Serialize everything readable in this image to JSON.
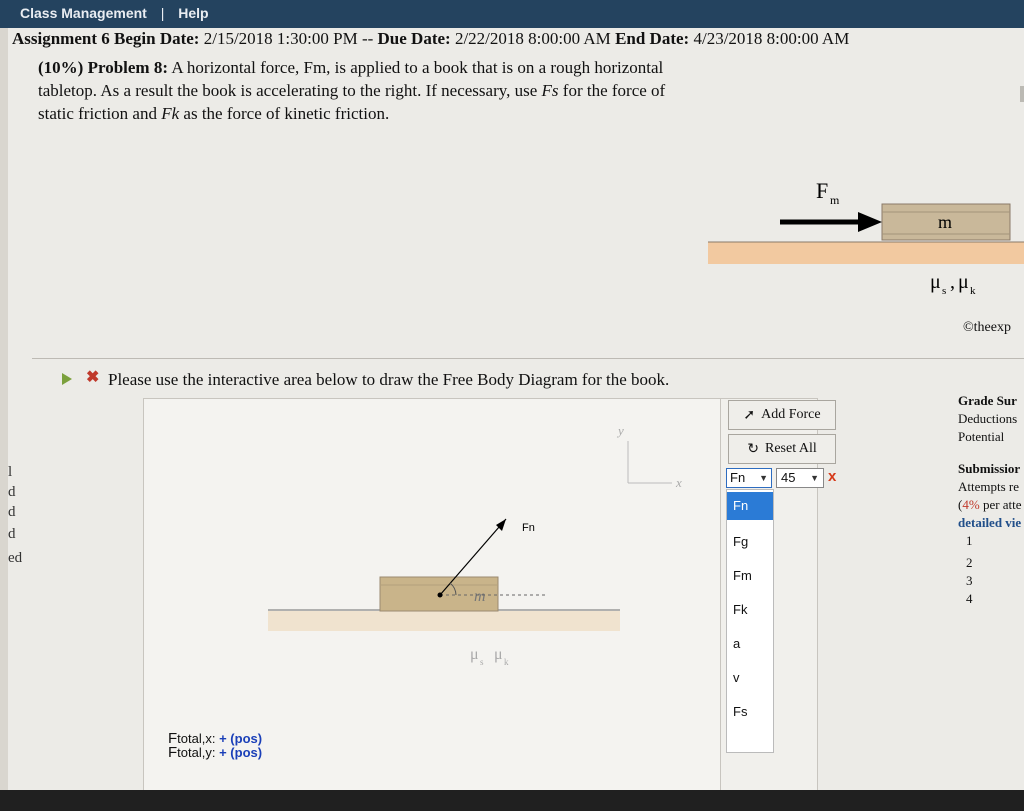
{
  "topbar": {
    "class_management": "Class Management",
    "separator": "|",
    "help": "Help"
  },
  "assignment": {
    "title": "Assignment 6",
    "begin_label": "Begin Date:",
    "begin_value": "2/15/2018 1:30:00 PM",
    "dash": "--",
    "due_label": "Due Date:",
    "due_value": "2/22/2018 8:00:00 AM",
    "end_label": "End Date:",
    "end_value": "4/23/2018 8:00:00 AM"
  },
  "problem": {
    "weight": "(10%)",
    "label": "Problem 8:",
    "text1": "A horizontal force, Fm, is applied to a book that is on a rough horizontal tabletop. As a result the book is accelerating to the right. If necessary, use",
    "fs": "Fs",
    "text2": "for the force of static friction and",
    "fk": "Fk",
    "text3": "as the force of kinetic friction."
  },
  "figure": {
    "force_label": "F",
    "force_sub": "m",
    "mass_label": "m",
    "mu_s": "μ",
    "s": "s",
    "mu_k": "μ",
    "k": "k",
    "copyright": "©theexp"
  },
  "left_edge_letters": [
    "l",
    "d",
    "d",
    "d",
    "ed"
  ],
  "instruction": "Please use the interactive area below to draw the Free Body Diagram for the book.",
  "fbd": {
    "y_axis": "y",
    "x_axis": "x",
    "force_label": "Fn",
    "mass_label": "m",
    "mu_s": "μ",
    "s": "s",
    "mu_k": "μ",
    "k": "k"
  },
  "controls": {
    "add_force": "Add Force",
    "reset_all": "Reset All",
    "selected_force": "Fn",
    "angle": "45",
    "remove": "x",
    "options": [
      "Fn",
      "Fg",
      "Fm",
      "Fk",
      "a",
      "v",
      "Fs"
    ]
  },
  "grade": {
    "summary": "Grade Sur",
    "deductions": "Deductions",
    "potential": "Potential",
    "submissions": "Submissior",
    "attempts": "Attempts re",
    "per_attempt_pct": "4%",
    "per_attempt": "per atte",
    "detailed": "detailed vie",
    "rows": [
      "1",
      "2",
      "3",
      "4"
    ]
  },
  "ftotal": {
    "x_label": "F",
    "x_sub": "total,x",
    "x_value": "+ (pos)",
    "y_label": "F",
    "y_sub": "total,y",
    "y_value": "+ (pos)"
  },
  "colors": {
    "topbar": "#24435f",
    "selected": "#2b7bd6",
    "table": "#f2c9a0"
  }
}
